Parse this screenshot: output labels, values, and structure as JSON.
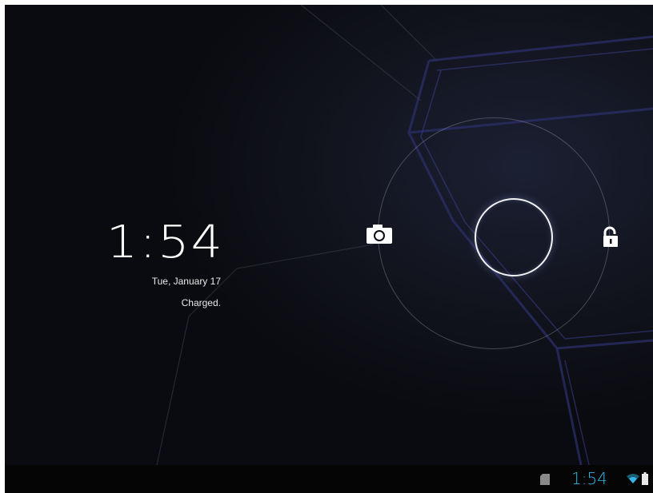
{
  "lockscreen": {
    "clock": "1:54",
    "date": "Tue, January 17",
    "status": "Charged."
  },
  "system_bar": {
    "clock": "1:54"
  },
  "icons": {
    "camera": "camera-icon",
    "unlock": "unlock-icon",
    "sd_card": "sd-card-icon",
    "wifi": "wifi-icon",
    "battery": "battery-icon"
  },
  "colors": {
    "background": "#0b0c12",
    "accent": "#33b5e5",
    "ring": "#f4f4f4"
  }
}
